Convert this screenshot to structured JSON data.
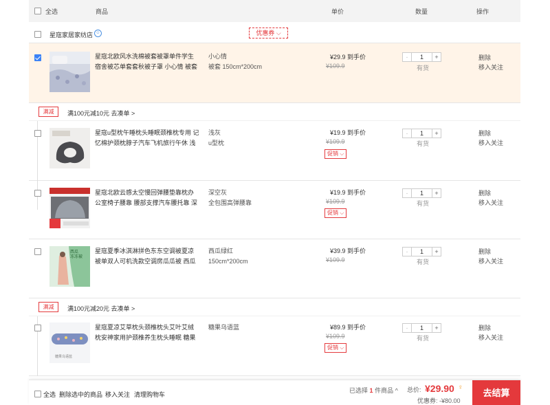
{
  "header": {
    "select_all": "全选",
    "goods": "商品",
    "price": "单价",
    "qty": "数量",
    "ops": "操作"
  },
  "shop": {
    "name": "星寇家居家纺店",
    "coupon": "优惠券 ⌵"
  },
  "promo_groups": [
    {
      "tag": "满减",
      "text": "满100元减10元  去凑单 >"
    },
    {
      "tag": "满减",
      "text": "满100元减20元  去凑单 >"
    }
  ],
  "items": [
    {
      "title": "星寇北欧风水洗棉被套被罩单件学生宿舍被芯单套套秋被子罩 小心情 被套",
      "spec1": "小心情",
      "spec2": "被套 150cm*200cm",
      "price": "¥29.9 到手价",
      "old_price": "¥109.9",
      "promo": "",
      "qty": "1",
      "stock": "有货",
      "del": "删除",
      "fav": "移入关注",
      "checked": true
    },
    {
      "title": "星寇u型枕午睡枕头睡眠颈椎枕专用 记忆棉护颈枕脖子汽车飞机旅行午休 浅",
      "spec1": "浅灰",
      "spec2": "u型枕",
      "price": "¥19.9 到手价",
      "old_price": "¥109.9",
      "promo": "促销 ⌵",
      "qty": "1",
      "stock": "有货",
      "del": "删除",
      "fav": "移入关注",
      "checked": false
    },
    {
      "title": "星寇北欧云感太空慢回弹腰垫靠枕办公室椅子腰靠 腰部支撑汽车腰托靠 深空",
      "spec1": "深空灰",
      "spec2": "全包围高弹腰靠",
      "price": "¥19.9 到手价",
      "old_price": "¥109.9",
      "promo": "促销 ⌵",
      "qty": "1",
      "stock": "有货",
      "del": "删除",
      "fav": "移入关注",
      "checked": false
    },
    {
      "title": "星寇夏季冰淇淋拼色东东空调被夏凉被单双人可机洗款空调房瓜瓜被 西瓜绿",
      "spec1": "西瓜绿红",
      "spec2": "150cm*200cm",
      "price": "¥39.9 到手价",
      "old_price": "¥109.9",
      "promo": "",
      "qty": "1",
      "stock": "有货",
      "del": "删除",
      "fav": "移入关注",
      "checked": false
    },
    {
      "title": "星寇夏凉艾草枕头颈椎枕头艾叶艾绒枕安神家用护颈椎养生枕头睡眠 糖果乌",
      "spec1": "糖果乌语蓝",
      "spec2": "",
      "price": "¥89.9 到手价",
      "old_price": "¥109.9",
      "promo": "促销 ⌵",
      "qty": "1",
      "stock": "有货",
      "del": "删除",
      "fav": "移入关注",
      "checked": false
    }
  ],
  "thumbs": {
    "item3_text": "西瓜\n冻冻被",
    "item4_text": "糖果乌语蓝"
  },
  "stepper": {
    "minus": "-",
    "plus": "+"
  },
  "footer": {
    "select_all": "全选",
    "delete_selected": "删除选中的商品",
    "move_fav": "移入关注",
    "clear": "清理购物车",
    "chosen_pre": "已选择",
    "chosen_num": "1",
    "chosen_post": "件商品 ^",
    "total_label": "总价:",
    "total": "¥29.90",
    "discount": "优惠券: -¥80.00",
    "checkout": "去结算"
  },
  "colors": {
    "accent": "#e4393c",
    "selected_row": "#fff4e8",
    "checkbox": "#3b82f6"
  }
}
